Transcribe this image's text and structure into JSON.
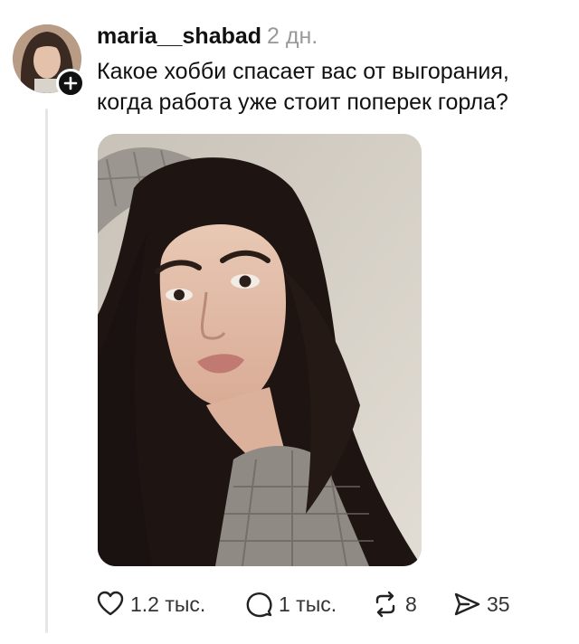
{
  "post": {
    "username": "maria__shabad",
    "time": "2 дн.",
    "text": "Какое хобби спасает вас от выгорания, когда работа уже стоит поперек горла?"
  },
  "icons": {
    "avatar": "profile-photo",
    "follow": "plus-icon",
    "like": "heart-icon",
    "reply": "speech-bubble-icon",
    "repost": "repost-arrows-icon",
    "share": "paper-plane-icon"
  },
  "actions": {
    "likes": "1.2 тыс.",
    "replies": "1 тыс.",
    "reposts": "8",
    "shares": "35"
  },
  "colors": {
    "text": "#111111",
    "muted": "#9a9a9a",
    "thread_line": "#e6e6e6"
  }
}
